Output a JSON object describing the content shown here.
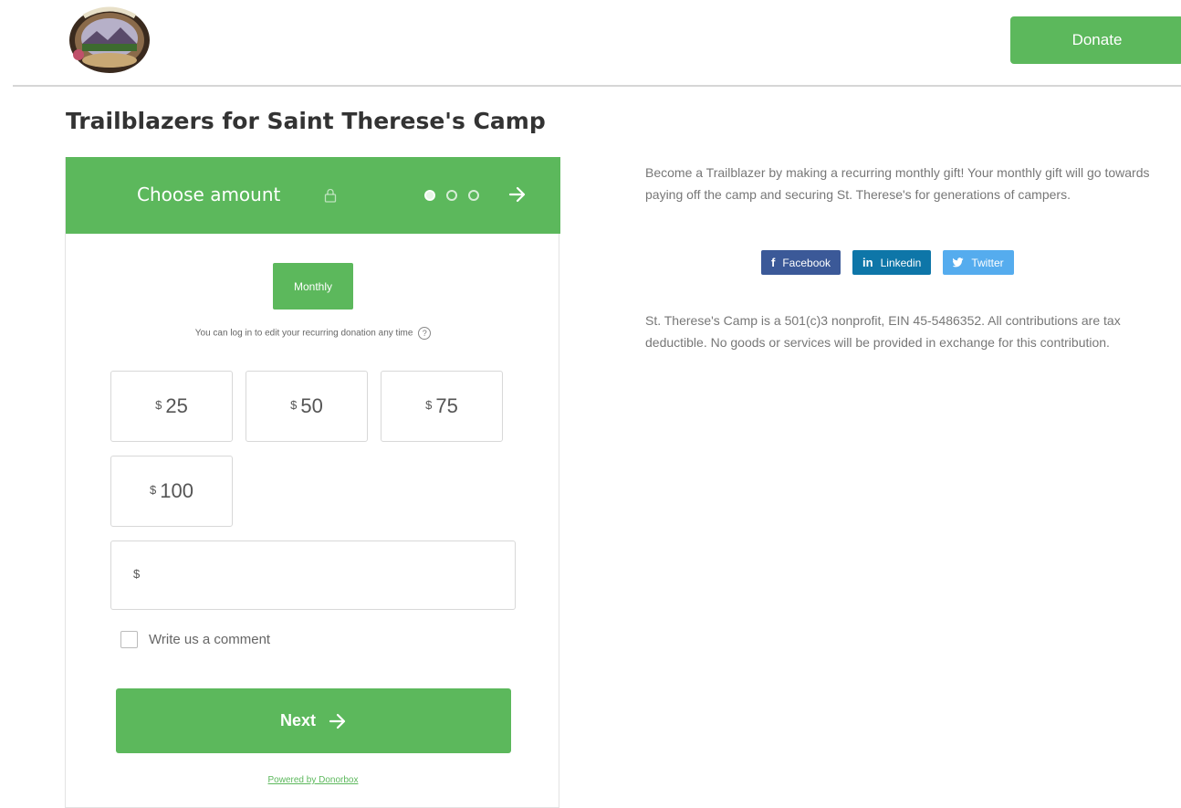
{
  "header": {
    "logo_alt": "St. Therese's Camp logo",
    "donate_label": "Donate"
  },
  "page_title": "Trailblazers for Saint Therese's Camp",
  "widget": {
    "step_title": "Choose amount",
    "step_total": 3,
    "step_current": 1,
    "frequency_label": "Monthly",
    "recurring_note": "You can log in to edit your recurring donation any time",
    "currency_symbol": "$",
    "amounts": [
      "25",
      "50",
      "75",
      "100"
    ],
    "custom_amount_value": "",
    "comment_label": "Write us a comment",
    "comment_checked": false,
    "next_label": "Next",
    "powered_by": "Powered by Donorbox"
  },
  "sidebar": {
    "description": "Become a Trailblazer by making a recurring monthly gift! Your monthly gift will go towards paying off the camp and securing St. Therese's for generations of campers.",
    "share": [
      {
        "label": "Facebook",
        "icon": "f"
      },
      {
        "label": "Linkedin",
        "icon": "in"
      },
      {
        "label": "Twitter",
        "icon": "bird"
      }
    ],
    "legal": "St. Therese's Camp is a 501(c)3 nonprofit, EIN 45-5486352. All contributions are tax deductible. No goods or services will be provided in exchange for this contribution."
  },
  "colors": {
    "accent": "#5cb85c",
    "facebook": "#3b5998",
    "linkedin": "#0e76a8",
    "twitter": "#55acee"
  }
}
